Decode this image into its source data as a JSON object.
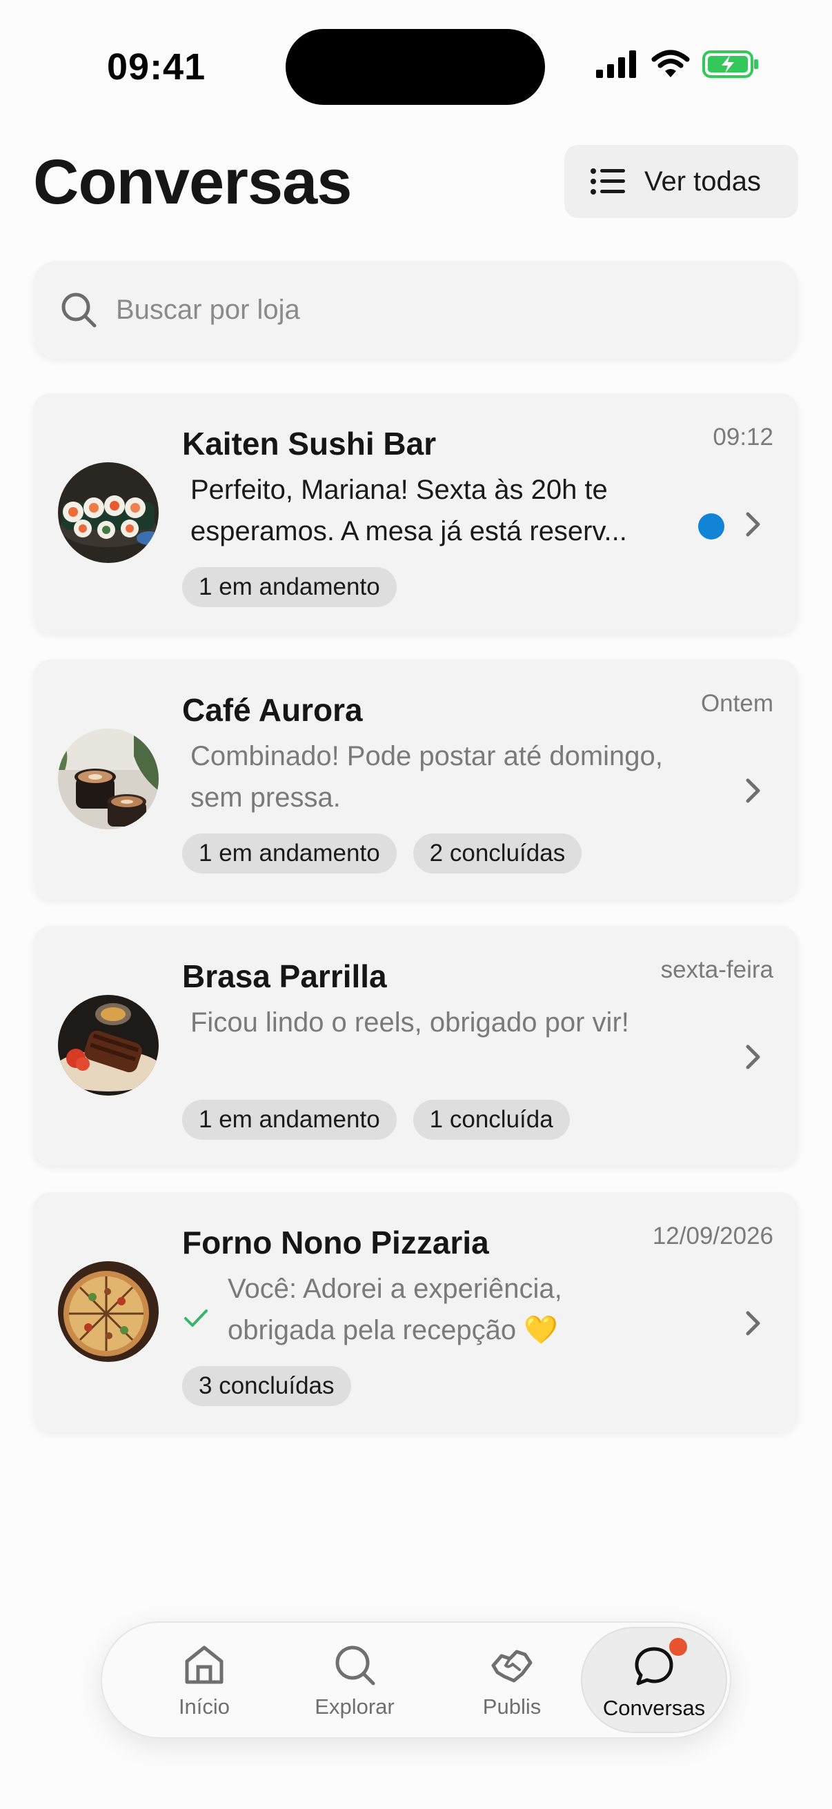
{
  "status_bar": {
    "time": "09:41"
  },
  "header": {
    "title": "Conversas",
    "view_all_label": "Ver todas"
  },
  "search": {
    "placeholder": "Buscar por loja",
    "value": ""
  },
  "conversations": [
    {
      "name": "Kaiten Sushi Bar",
      "time": "09:12",
      "message": "Perfeito, Mariana! Sexta às 20h te esperamos. A mesa já está reserv...",
      "unread": true,
      "sent_by_me": false,
      "chips": [
        "1 em andamento"
      ]
    },
    {
      "name": "Café Aurora",
      "time": "Ontem",
      "message": "Combinado! Pode postar até domingo, sem pressa.",
      "unread": false,
      "sent_by_me": false,
      "chips": [
        "1 em andamento",
        "2 concluídas"
      ]
    },
    {
      "name": "Brasa Parrilla",
      "time": "sexta-feira",
      "message": "Ficou lindo o reels, obrigado por vir!",
      "unread": false,
      "sent_by_me": false,
      "chips": [
        "1 em andamento",
        "1 concluída"
      ]
    },
    {
      "name": "Forno Nono Pizzaria",
      "time": "12/09/2026",
      "message": "Você: Adorei a experiência, obrigada pela recepção 💛",
      "unread": false,
      "sent_by_me": true,
      "chips": [
        "3 concluídas"
      ]
    }
  ],
  "nav": {
    "items": [
      {
        "label": "Início",
        "icon": "home-icon"
      },
      {
        "label": "Explorar",
        "icon": "search-icon"
      },
      {
        "label": "Publis",
        "icon": "handshake-icon"
      },
      {
        "label": "Conversas",
        "icon": "chat-bubble-icon"
      }
    ],
    "active": "Conversas"
  },
  "colors": {
    "unread_dot": "#1284d6",
    "check": "#3bb36a",
    "badge": "#e8532f",
    "battery": "#34c759"
  }
}
